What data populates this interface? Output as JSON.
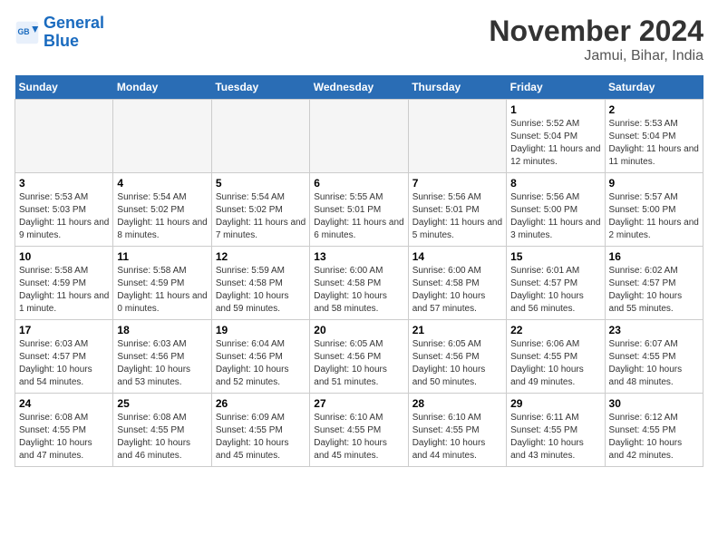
{
  "header": {
    "logo_line1": "General",
    "logo_line2": "Blue",
    "month": "November 2024",
    "location": "Jamui, Bihar, India"
  },
  "weekdays": [
    "Sunday",
    "Monday",
    "Tuesday",
    "Wednesday",
    "Thursday",
    "Friday",
    "Saturday"
  ],
  "weeks": [
    [
      {
        "day": "",
        "empty": true
      },
      {
        "day": "",
        "empty": true
      },
      {
        "day": "",
        "empty": true
      },
      {
        "day": "",
        "empty": true
      },
      {
        "day": "",
        "empty": true
      },
      {
        "day": "1",
        "sunrise": "5:52 AM",
        "sunset": "5:04 PM",
        "daylight": "11 hours and 12 minutes."
      },
      {
        "day": "2",
        "sunrise": "5:53 AM",
        "sunset": "5:04 PM",
        "daylight": "11 hours and 11 minutes."
      }
    ],
    [
      {
        "day": "3",
        "sunrise": "5:53 AM",
        "sunset": "5:03 PM",
        "daylight": "11 hours and 9 minutes."
      },
      {
        "day": "4",
        "sunrise": "5:54 AM",
        "sunset": "5:02 PM",
        "daylight": "11 hours and 8 minutes."
      },
      {
        "day": "5",
        "sunrise": "5:54 AM",
        "sunset": "5:02 PM",
        "daylight": "11 hours and 7 minutes."
      },
      {
        "day": "6",
        "sunrise": "5:55 AM",
        "sunset": "5:01 PM",
        "daylight": "11 hours and 6 minutes."
      },
      {
        "day": "7",
        "sunrise": "5:56 AM",
        "sunset": "5:01 PM",
        "daylight": "11 hours and 5 minutes."
      },
      {
        "day": "8",
        "sunrise": "5:56 AM",
        "sunset": "5:00 PM",
        "daylight": "11 hours and 3 minutes."
      },
      {
        "day": "9",
        "sunrise": "5:57 AM",
        "sunset": "5:00 PM",
        "daylight": "11 hours and 2 minutes."
      }
    ],
    [
      {
        "day": "10",
        "sunrise": "5:58 AM",
        "sunset": "4:59 PM",
        "daylight": "11 hours and 1 minute."
      },
      {
        "day": "11",
        "sunrise": "5:58 AM",
        "sunset": "4:59 PM",
        "daylight": "11 hours and 0 minutes."
      },
      {
        "day": "12",
        "sunrise": "5:59 AM",
        "sunset": "4:58 PM",
        "daylight": "10 hours and 59 minutes."
      },
      {
        "day": "13",
        "sunrise": "6:00 AM",
        "sunset": "4:58 PM",
        "daylight": "10 hours and 58 minutes."
      },
      {
        "day": "14",
        "sunrise": "6:00 AM",
        "sunset": "4:58 PM",
        "daylight": "10 hours and 57 minutes."
      },
      {
        "day": "15",
        "sunrise": "6:01 AM",
        "sunset": "4:57 PM",
        "daylight": "10 hours and 56 minutes."
      },
      {
        "day": "16",
        "sunrise": "6:02 AM",
        "sunset": "4:57 PM",
        "daylight": "10 hours and 55 minutes."
      }
    ],
    [
      {
        "day": "17",
        "sunrise": "6:03 AM",
        "sunset": "4:57 PM",
        "daylight": "10 hours and 54 minutes."
      },
      {
        "day": "18",
        "sunrise": "6:03 AM",
        "sunset": "4:56 PM",
        "daylight": "10 hours and 53 minutes."
      },
      {
        "day": "19",
        "sunrise": "6:04 AM",
        "sunset": "4:56 PM",
        "daylight": "10 hours and 52 minutes."
      },
      {
        "day": "20",
        "sunrise": "6:05 AM",
        "sunset": "4:56 PM",
        "daylight": "10 hours and 51 minutes."
      },
      {
        "day": "21",
        "sunrise": "6:05 AM",
        "sunset": "4:56 PM",
        "daylight": "10 hours and 50 minutes."
      },
      {
        "day": "22",
        "sunrise": "6:06 AM",
        "sunset": "4:55 PM",
        "daylight": "10 hours and 49 minutes."
      },
      {
        "day": "23",
        "sunrise": "6:07 AM",
        "sunset": "4:55 PM",
        "daylight": "10 hours and 48 minutes."
      }
    ],
    [
      {
        "day": "24",
        "sunrise": "6:08 AM",
        "sunset": "4:55 PM",
        "daylight": "10 hours and 47 minutes."
      },
      {
        "day": "25",
        "sunrise": "6:08 AM",
        "sunset": "4:55 PM",
        "daylight": "10 hours and 46 minutes."
      },
      {
        "day": "26",
        "sunrise": "6:09 AM",
        "sunset": "4:55 PM",
        "daylight": "10 hours and 45 minutes."
      },
      {
        "day": "27",
        "sunrise": "6:10 AM",
        "sunset": "4:55 PM",
        "daylight": "10 hours and 45 minutes."
      },
      {
        "day": "28",
        "sunrise": "6:10 AM",
        "sunset": "4:55 PM",
        "daylight": "10 hours and 44 minutes."
      },
      {
        "day": "29",
        "sunrise": "6:11 AM",
        "sunset": "4:55 PM",
        "daylight": "10 hours and 43 minutes."
      },
      {
        "day": "30",
        "sunrise": "6:12 AM",
        "sunset": "4:55 PM",
        "daylight": "10 hours and 42 minutes."
      }
    ]
  ]
}
